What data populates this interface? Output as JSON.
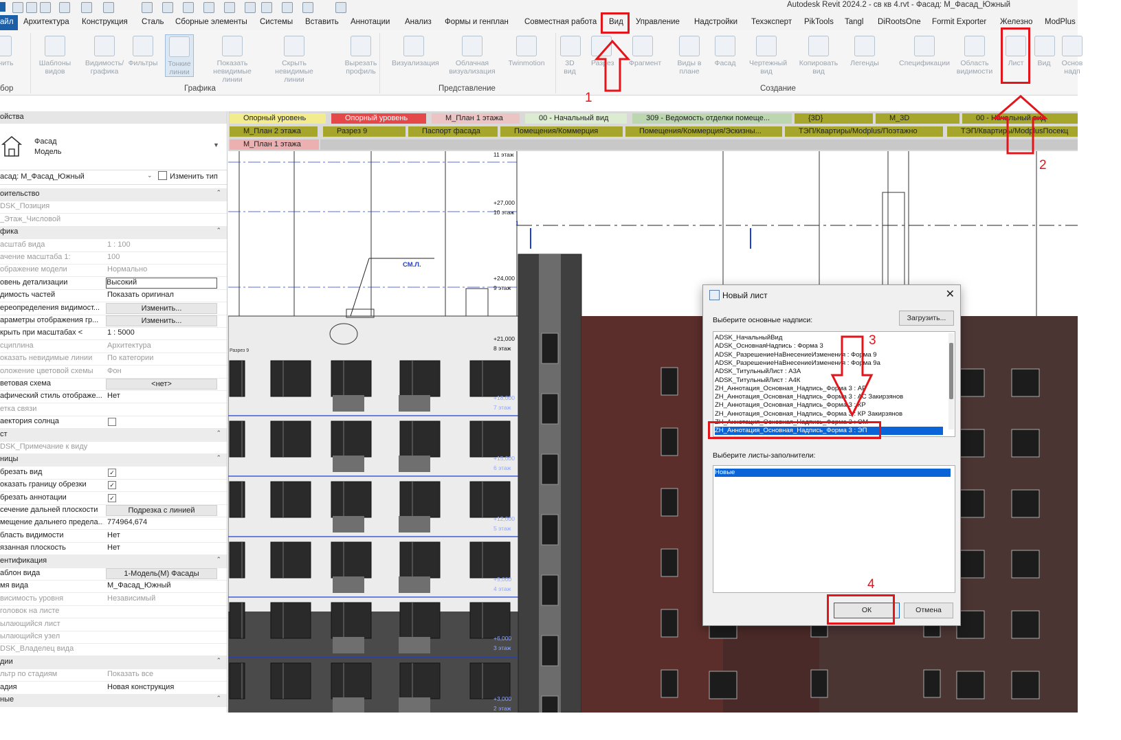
{
  "window": {
    "title": "Autodesk Revit 2024.2 - св кв 4.rvt - Фасад: М_Фасад_Южный"
  },
  "menu": {
    "file": "айл",
    "tabs": [
      "Архитектура",
      "Конструкция",
      "Сталь",
      "Сборные элементы",
      "Системы",
      "Вставить",
      "Аннотации",
      "Анализ",
      "Формы и генплан",
      "Совместная работа",
      "Вид",
      "Управление",
      "Надстройки",
      "Техэксперт",
      "PikTools",
      "Tangl",
      "DiRootsOne",
      "Formit Exporter",
      "Железно",
      "ModPlus"
    ]
  },
  "ribbon": {
    "buttons": [
      "менить",
      "Шаблоны видов",
      "Видимость/ графика",
      "Фильтры",
      "Тонкие линии",
      "Показать невидимые линии",
      "Скрыть невидимые линии",
      "Вырезать профиль",
      "Визуализация",
      "Облачная визуализация",
      "Twinmotion",
      "3D вид",
      "Разрез",
      "Фрагмент",
      "Виды в плане",
      "Фасад",
      "Чертежный вид",
      "Копировать вид",
      "Легенды",
      "Спецификации",
      "Область видимости",
      "Лист",
      "Вид",
      "Основ надп"
    ],
    "panels": {
      "select": "бор",
      "graphics": "Графика",
      "presentation": "Представление",
      "create": "Создание"
    }
  },
  "properties": {
    "header": "ойства",
    "type_name": "Фасад",
    "type_sub": "Модель",
    "selector": "асад: М_Фасад_Южный",
    "edit_type": "Изменить тип",
    "rows": [
      {
        "n": "оительство",
        "v": "",
        "kind": "sec"
      },
      {
        "n": "DSK_Позиция",
        "v": "",
        "kind": "dim"
      },
      {
        "n": "_Этаж_Числовой",
        "v": "",
        "kind": "dim"
      },
      {
        "n": "фика",
        "v": "",
        "kind": "sec"
      },
      {
        "n": "асштаб вида",
        "v": "1 : 100",
        "kind": "dim"
      },
      {
        "n": "ачение масштаба   1:",
        "v": "100",
        "kind": "dim"
      },
      {
        "n": "ображение модели",
        "v": "Нормально",
        "kind": "dim"
      },
      {
        "n": "овень детализации",
        "v": "Высокий",
        "kind": "box"
      },
      {
        "n": "димость частей",
        "v": "Показать оригинал",
        "kind": "norm"
      },
      {
        "n": "ереопределения видимост...",
        "v": "Изменить...",
        "kind": "btn"
      },
      {
        "n": "араметры отображения гр...",
        "v": "Изменить...",
        "kind": "btn"
      },
      {
        "n": "крыть при масштабах <",
        "v": "1 : 5000",
        "kind": "norm"
      },
      {
        "n": "сциплина",
        "v": "Архитектура",
        "kind": "dim"
      },
      {
        "n": "оказать невидимые линии",
        "v": "По категории",
        "kind": "dim"
      },
      {
        "n": "оложение цветовой схемы",
        "v": "Фон",
        "kind": "dim"
      },
      {
        "n": "ветовая схема",
        "v": "<нет>",
        "kind": "btn"
      },
      {
        "n": "афический стиль отображе...",
        "v": "Нет",
        "kind": "norm"
      },
      {
        "n": "етка связи",
        "v": "",
        "kind": "dim"
      },
      {
        "n": "аектория солнца",
        "v": "",
        "kind": "chk0"
      },
      {
        "n": "ст",
        "v": "",
        "kind": "sec"
      },
      {
        "n": "DSK_Примечание к виду",
        "v": "",
        "kind": "dim"
      },
      {
        "n": "ницы",
        "v": "",
        "kind": "sec"
      },
      {
        "n": "брезать вид",
        "v": "",
        "kind": "chk1"
      },
      {
        "n": "оказать границу обрезки",
        "v": "",
        "kind": "chk1"
      },
      {
        "n": "брезать аннотации",
        "v": "",
        "kind": "chk1"
      },
      {
        "n": "сечение дальней плоскости",
        "v": "Подрезка с линией",
        "kind": "btn"
      },
      {
        "n": "мещение дальнего предела...",
        "v": "774964,674",
        "kind": "norm"
      },
      {
        "n": "бласть видимости",
        "v": "Нет",
        "kind": "norm"
      },
      {
        "n": "язанная плоскость",
        "v": "Нет",
        "kind": "norm"
      },
      {
        "n": "ентификация",
        "v": "",
        "kind": "sec"
      },
      {
        "n": "аблон вида",
        "v": "1-Модель(М) Фасады",
        "kind": "btn"
      },
      {
        "n": "мя вида",
        "v": "М_Фасад_Южный",
        "kind": "norm"
      },
      {
        "n": "висимость уровня",
        "v": "Независимый",
        "kind": "dim"
      },
      {
        "n": "головок на листе",
        "v": "",
        "kind": "dim"
      },
      {
        "n": "ылающийся лист",
        "v": "",
        "kind": "dim"
      },
      {
        "n": "ылающийся узел",
        "v": "",
        "kind": "dim"
      },
      {
        "n": "DSK_Владелец вида",
        "v": "",
        "kind": "dim"
      },
      {
        "n": "дии",
        "v": "",
        "kind": "sec"
      },
      {
        "n": "льтр по стадиям",
        "v": "Показать все",
        "kind": "dim"
      },
      {
        "n": "адия",
        "v": "Новая конструкция",
        "kind": "norm"
      },
      {
        "n": "ные",
        "v": "",
        "kind": "sec"
      }
    ]
  },
  "view_tabs": [
    {
      "label": "Опорный уровень",
      "color": "#f2ec8f"
    },
    {
      "label": "Опорный уровень",
      "color": "#e54848"
    },
    {
      "label": "М_План 1 этажа",
      "color": "#ecc4c4"
    },
    {
      "label": "00 - Начальный вид",
      "color": "#dcecd0"
    },
    {
      "label": "309 - Ведомость отделки помеще...",
      "color": "#bcd7b0"
    },
    {
      "label": "{3D}",
      "color": "#a6a62c"
    },
    {
      "label": "М_3D",
      "color": "#a6a62c"
    },
    {
      "label": "00 - Начальный вид",
      "color": "#a6a62c"
    },
    {
      "label": "М_План 2 этажа",
      "color": "#a6a62c"
    },
    {
      "label": "Разрез 9",
      "color": "#a6a62c"
    },
    {
      "label": "Паспорт фасада",
      "color": "#a6a62c"
    },
    {
      "label": "Помещения/Коммерция",
      "color": "#a6a62c"
    },
    {
      "label": "Помещения/Коммерция/Эскизны...",
      "color": "#a6a62c"
    },
    {
      "label": "ТЭП/Квартиры/Modplus/Поэтажно",
      "color": "#a6a62c"
    },
    {
      "label": "ТЭП/Квартиры/ModplusПосекц",
      "color": "#a6a62c"
    },
    {
      "label": "М_План 1 этажа",
      "color": "#ecb0b0"
    }
  ],
  "drawing": {
    "levels": [
      {
        "elev": "+27,000",
        "name": "10 этаж"
      },
      {
        "elev": "+24,000",
        "name": "9 этаж"
      },
      {
        "elev": "+21,000",
        "name": "8 этаж"
      },
      {
        "elev": "+18,000",
        "name": "7 этаж"
      },
      {
        "elev": "+15,000",
        "name": "6 этаж"
      },
      {
        "elev": "+12,000",
        "name": "5 этаж"
      },
      {
        "elev": "+9,000",
        "name": "4 этаж"
      },
      {
        "elev": "+6,000",
        "name": "3 этаж"
      },
      {
        "elev": "+3,000",
        "name": "2 этаж"
      }
    ],
    "top_level": "11 этаж",
    "note": "СМ.Л.",
    "section_mark": "Разрез 9",
    "grid_mark": "1"
  },
  "dialog": {
    "title": "Новый лист",
    "label_titleblocks": "Выберите основные надписи:",
    "load_button": "Загрузить...",
    "titleblocks": [
      "ADSK_НачальныйВид",
      "ADSK_ОсновнаяНадпись : Форма 3",
      "ADSK_РазрешениеНаВнесениеИзменения : Форма 9",
      "ADSK_РазрешениеНаВнесениеИзменения : Форма 9а",
      "ADSK_ТитульныйЛист : А3А",
      "ADSK_ТитульныйЛист : А4К",
      "ZH_Аннотация_Основная_Надпись_Форма 3 : АР",
      "ZH_Аннотация_Основная_Надпись_Форма 3 : АС Закирзянов",
      "ZH_Аннотация_Основная_Надпись_Форма 3 : КР",
      "ZH_Аннотация_Основная_Надпись_Форма 3 : КР Закирзянов",
      "ZH_Аннотация_Основная_Надпись_Форма 3 : ОМ",
      "ZH_Аннотация_Основная_Надпись_Форма 3 : ЭП"
    ],
    "selected_index": 11,
    "label_placeholders": "Выберите листы-заполнители:",
    "placeholders": [
      "Новые"
    ],
    "ok": "ОК",
    "cancel": "Отмена"
  },
  "annotations": {
    "n1": "1",
    "n2": "2",
    "n3": "3",
    "n4": "4",
    "color": "#e3141a"
  }
}
